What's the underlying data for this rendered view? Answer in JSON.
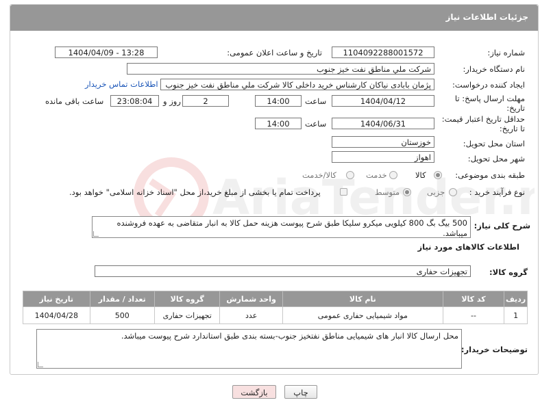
{
  "header": {
    "title": "جزئیات اطلاعات نیاز"
  },
  "fields": {
    "need_number_label": "شماره نیاز:",
    "need_number": "1104092288001572",
    "announce_label": "تاریخ و ساعت اعلان عمومی:",
    "announce_value": "1404/04/09 - 13:28",
    "buyer_org_label": "نام دستگاه خریدار:",
    "buyer_org": "شرکت ملي مناطق نفت خيز جنوب",
    "creator_label": "ایجاد کننده درخواست:",
    "creator": "پژمان  بابادی نیاکان  کارشناس خرید داخلی کالا  شرکت ملي مناطق نفت خيز جنوب",
    "contact_link": "اطلاعات تماس خریدار",
    "deadline_label_1": "مهلت ارسال پاسخ: تا",
    "deadline_label_2": "تاریخ:",
    "deadline_date": "1404/04/12",
    "time_label": "ساعت",
    "deadline_time": "14:00",
    "days_value": "2",
    "days_label": "روز و",
    "remaining_time": "23:08:04",
    "remaining_label": "ساعت باقی مانده",
    "price_validity_label_1": "حداقل تاریخ اعتبار قیمت:",
    "price_validity_label_2": "تا تاریخ:",
    "price_validity_date": "1404/06/31",
    "price_validity_time": "14:00",
    "province_label": "استان محل تحویل:",
    "province": "خوزستان",
    "city_label": "شهر محل تحویل:",
    "city": "اهواز",
    "category_label": "طبقه بندی موضوعی:",
    "category_options": [
      "کالا",
      "خدمت",
      "کالا/خدمت"
    ],
    "category_selected": "کالا",
    "process_label": "نوع فرآیند خرید :",
    "process_options": [
      "جزیی",
      "متوسط"
    ],
    "process_selected": "متوسط",
    "payment_note": "پرداخت تمام یا بخشی از مبلغ خرید،از محل \"اسناد خزانه اسلامی\" خواهد بود."
  },
  "summary": {
    "label": "شرح کلی نیاز:",
    "text": "500 بیگ بگ 800 کیلویی میکرو سلیکا طبق شرح پیوست هزینه حمل کالا به انبار متقاضی به عهده فروشنده میباشد."
  },
  "goods_section": {
    "title": "اطلاعات کالاهای مورد نیاز",
    "group_label": "گروه کالا:",
    "group_value": "تجهیزات حفاری"
  },
  "table": {
    "headers": [
      "ردیف",
      "کد کالا",
      "نام کالا",
      "واحد شمارش",
      "گروه کالا",
      "تعداد / مقدار",
      "تاریخ نیاز"
    ],
    "rows": [
      [
        "1",
        "--",
        "مواد شیمیایی حفاری عمومی",
        "عدد",
        "تجهیزات حفاری",
        "500",
        "1404/04/28"
      ]
    ]
  },
  "buyer_notes": {
    "label": "توضیحات خریدار:",
    "text": "محل ارسال کالا انبار های شیمیایی مناطق نفتخیز جنوب-بسته بندی طبق استاندارد شرح پیوست میباشد."
  },
  "buttons": {
    "print": "چاپ",
    "back": "بازگشت"
  },
  "watermark": {
    "text": "AriaTender.neT"
  },
  "colors": {
    "header_bg": "#979797",
    "link": "#1a55b8",
    "back_button_bg": "#f8e0e0"
  }
}
